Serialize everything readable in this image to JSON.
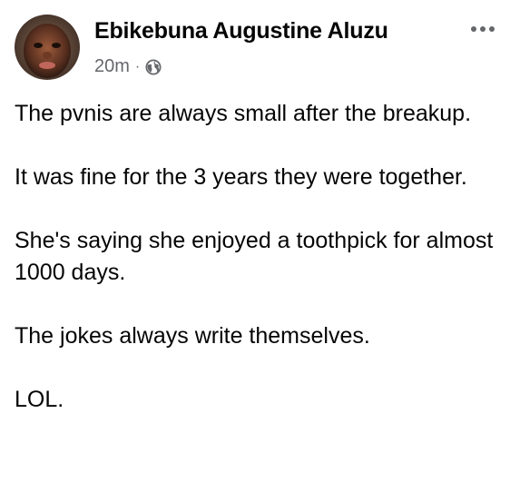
{
  "post": {
    "author": "Ebikebuna Augustine Aluzu",
    "timestamp": "20m",
    "separator": "·",
    "audience_icon": "globe-icon",
    "menu_icon": "more-options-icon",
    "paragraphs": [
      "The pvnis are always small after the breakup.",
      "It was fine for the 3 years they were together.",
      "She's saying she enjoyed a toothpick for almost 1000 days.",
      "The jokes always write themselves.",
      "LOL."
    ]
  },
  "colors": {
    "text": "#050505",
    "secondary": "#65676b",
    "background": "#ffffff"
  }
}
